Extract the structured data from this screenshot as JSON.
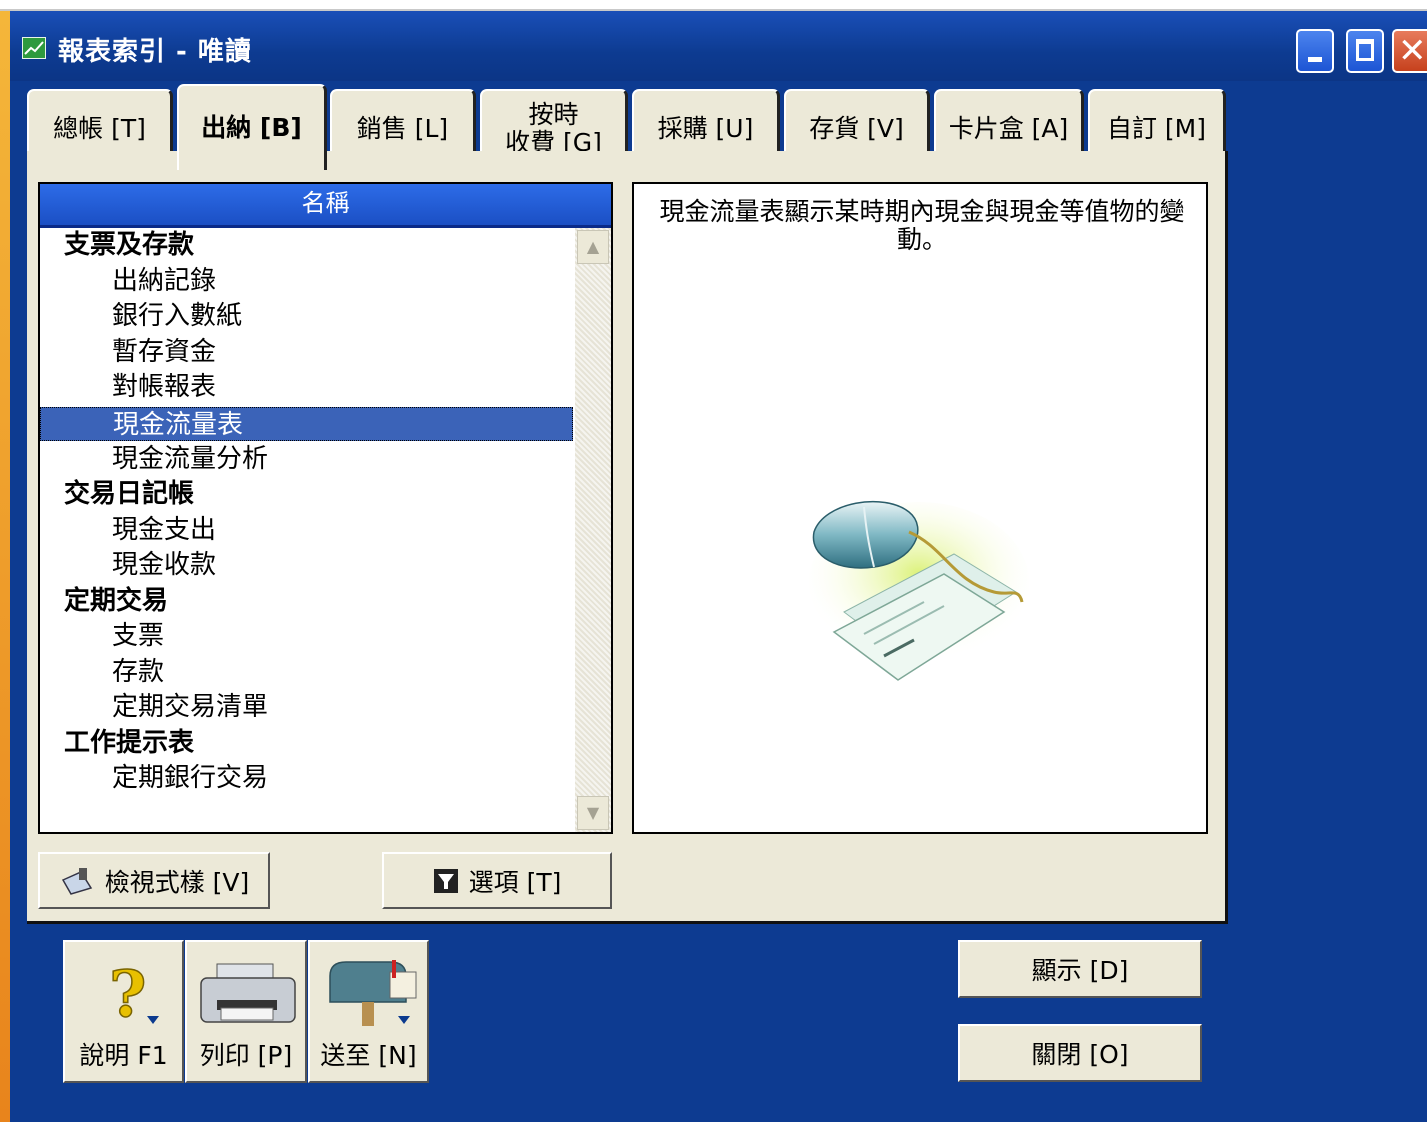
{
  "window": {
    "title": "報表索引 - 唯讀",
    "min_icon": "minimize-icon",
    "max_icon": "maximize-icon",
    "close_icon": "close-icon",
    "close_glyph": "✕"
  },
  "tabs": [
    {
      "label": "總帳 [T]"
    },
    {
      "label": "出納 [B]",
      "active": true
    },
    {
      "label": "銷售 [L]"
    },
    {
      "label": "按時收費 [G]",
      "line1": "按時",
      "line2": "收費 [G]"
    },
    {
      "label": "採購 [U]"
    },
    {
      "label": "存貨 [V]"
    },
    {
      "label": "卡片盒 [A]"
    },
    {
      "label": "自訂 [M]"
    }
  ],
  "report_list": {
    "header": "名稱",
    "items": [
      {
        "label": "支票及存款",
        "type": "category"
      },
      {
        "label": "出納記錄",
        "type": "item"
      },
      {
        "label": "銀行入數紙",
        "type": "item"
      },
      {
        "label": "暫存資金",
        "type": "item"
      },
      {
        "label": "對帳報表",
        "type": "item"
      },
      {
        "label": "現金流量表",
        "type": "item",
        "selected": true
      },
      {
        "label": "現金流量分析",
        "type": "item"
      },
      {
        "label": "交易日記帳",
        "type": "category"
      },
      {
        "label": "現金支出",
        "type": "item"
      },
      {
        "label": "現金收款",
        "type": "item"
      },
      {
        "label": "定期交易",
        "type": "category"
      },
      {
        "label": "支票",
        "type": "item"
      },
      {
        "label": "存款",
        "type": "item"
      },
      {
        "label": "定期交易清單",
        "type": "item"
      },
      {
        "label": "工作提示表",
        "type": "category"
      },
      {
        "label": "定期銀行交易",
        "type": "item"
      }
    ],
    "scroll_up_glyph": "▲",
    "scroll_down_glyph": "▼"
  },
  "description": {
    "text": "現金流量表顯示某時期內現金與現金等值物的變動。",
    "illustration": "mouse-and-cheque-icon"
  },
  "panel_buttons": {
    "view_style": "檢視式樣 [V]",
    "options": "選項 [T]"
  },
  "toolbar": {
    "help": "說明 F1",
    "print": "列印 [P]",
    "send": "送至 [N]"
  },
  "actions": {
    "display": "顯示 [D]",
    "close": "關閉 [O]"
  },
  "colors": {
    "desktop": "#0b3a8e",
    "panel": "#ece9d8",
    "selection": "#3b63b8",
    "list_header": "#2d6ce8"
  }
}
